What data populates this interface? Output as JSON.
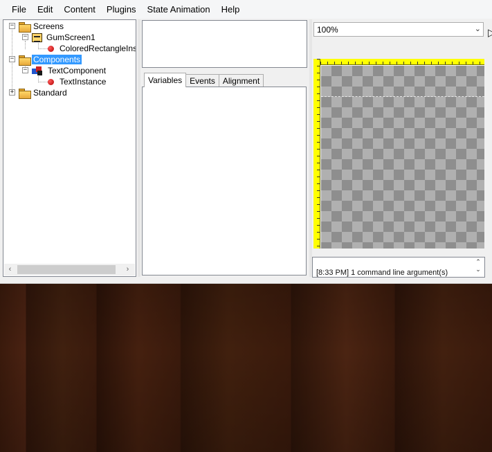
{
  "menu": [
    "File",
    "Edit",
    "Content",
    "Plugins",
    "State Animation",
    "Help"
  ],
  "tree": {
    "screens_label": "Screens",
    "gumscreen_label": "GumScreen1",
    "colored_rect_label": "ColoredRectangleInstance",
    "components_label": "Components",
    "text_component_label": "TextComponent",
    "text_instance_label": "TextInstance",
    "standard_label": "Standard",
    "expand_minus": "−",
    "expand_plus": "+"
  },
  "scroll": {
    "left_arrow": "‹",
    "right_arrow": "›"
  },
  "tabs": {
    "variables": "Variables",
    "events": "Events",
    "alignment": "Alignment"
  },
  "zoom": {
    "value": "100%",
    "arrow": "⌄"
  },
  "output": {
    "text": "[8:33 PM] 1 command line argument(s)",
    "scroll_up": "⌃",
    "scroll_down": "⌄"
  },
  "icons": {
    "folder": "folder-icon",
    "screen": "screen-icon",
    "component": "component-icon",
    "instance": "instance-icon"
  },
  "colors": {
    "selection": "#3399ff",
    "ruler": "#ffff00",
    "desk": "#3a1a0c"
  }
}
